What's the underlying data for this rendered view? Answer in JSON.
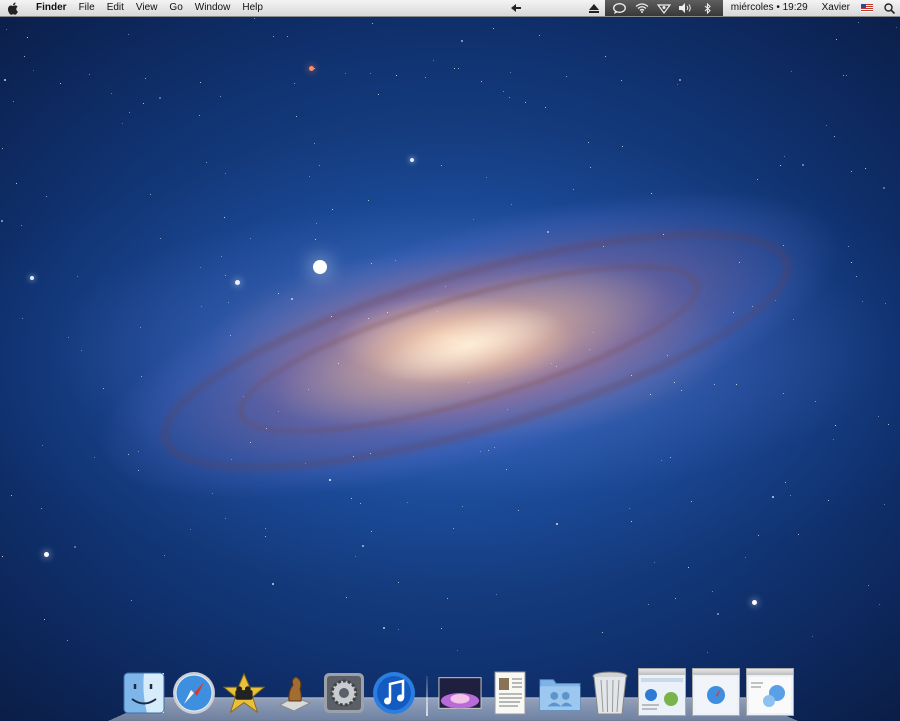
{
  "menubar": {
    "apple_icon": "apple-icon",
    "app_name": "Finder",
    "menus": [
      "File",
      "Edit",
      "View",
      "Go",
      "Window",
      "Help"
    ],
    "status_icons": [
      "back-arrow-icon",
      "eject-icon",
      "chat-bubble-icon",
      "wifi-icon",
      "sync-icon",
      "volume-icon",
      "bluetooth-icon"
    ],
    "clock": "miércoles • 19:29",
    "user": "Xavier",
    "flag_icon": "us-flag-icon",
    "spotlight_icon": "search-icon"
  },
  "dock": {
    "apps": [
      {
        "name": "finder-icon"
      },
      {
        "name": "safari-icon"
      },
      {
        "name": "imovie-icon"
      },
      {
        "name": "chess-icon"
      },
      {
        "name": "system-preferences-icon"
      },
      {
        "name": "itunes-icon"
      }
    ],
    "others": [
      {
        "name": "desktop-stack-icon"
      },
      {
        "name": "documents-stack-icon"
      },
      {
        "name": "applications-folder-icon"
      },
      {
        "name": "trash-icon"
      },
      {
        "name": "minimized-window-1"
      },
      {
        "name": "minimized-window-2"
      },
      {
        "name": "minimized-window-3"
      }
    ]
  },
  "colors": {
    "wallpaper_base": "#0f2f6b",
    "galaxy_core": "#ffebcd",
    "menubar_bg": "#e8e8e8"
  }
}
